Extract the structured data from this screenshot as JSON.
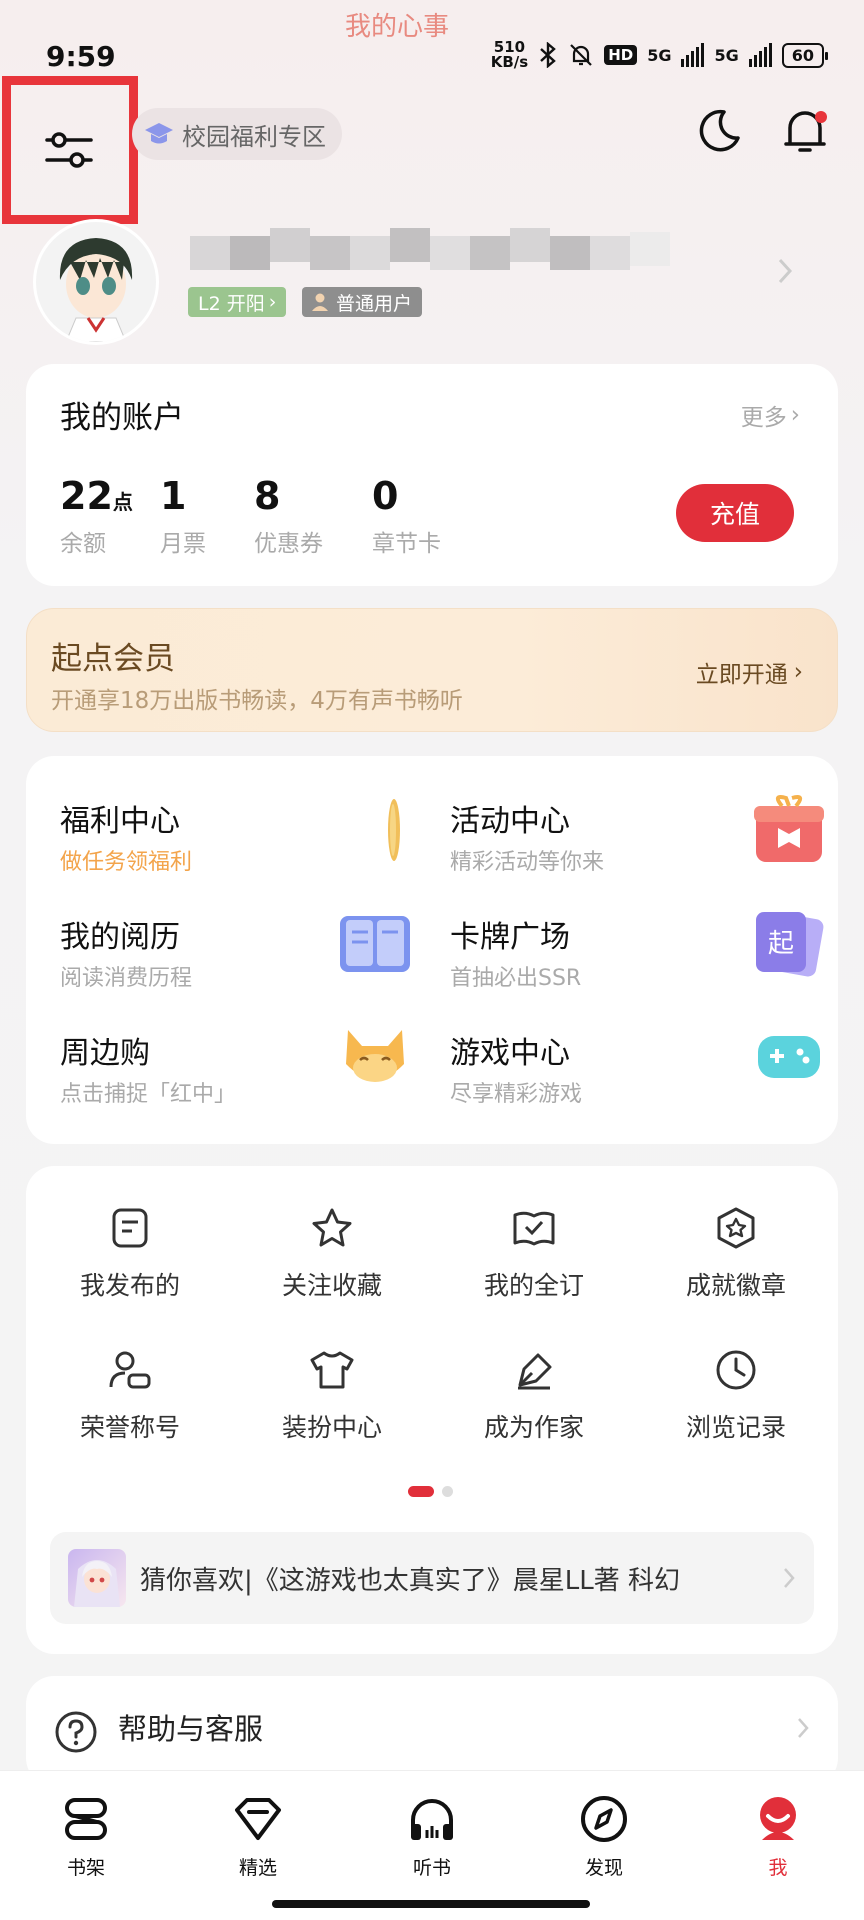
{
  "status_bar": {
    "time": "9:59",
    "top_tag": "我的心事",
    "net_speed_top": "510",
    "net_speed_unit": "KB/s",
    "hd_label": "HD",
    "sim1": "5G",
    "sim2": "5G",
    "battery": "60"
  },
  "header": {
    "campus_zone": "校园福利专区"
  },
  "profile": {
    "level_badge": "L2 开阳",
    "user_type": "普通用户"
  },
  "account": {
    "title": "我的账户",
    "more": "更多",
    "stats": [
      {
        "value": "22",
        "unit": "点",
        "label": "余额"
      },
      {
        "value": "1",
        "unit": "",
        "label": "月票"
      },
      {
        "value": "8",
        "unit": "",
        "label": "优惠券"
      },
      {
        "value": "0",
        "unit": "",
        "label": "章节卡"
      }
    ],
    "recharge": "充值"
  },
  "vip": {
    "title": "起点会员",
    "subtitle": "开通享18万出版书畅读，4万有声书畅听",
    "action": "立即开通"
  },
  "functions": [
    {
      "title": "福利中心",
      "subtitle": "做任务领福利",
      "icon": "coin-icon"
    },
    {
      "title": "活动中心",
      "subtitle": "精彩活动等你来",
      "icon": "gift-box-icon"
    },
    {
      "title": "我的阅历",
      "subtitle": "阅读消费历程",
      "icon": "open-book-icon"
    },
    {
      "title": "卡牌广场",
      "subtitle": "首抽必出SSR",
      "icon": "cards-icon"
    },
    {
      "title": "周边购",
      "subtitle": "点击捕捉「红中」",
      "icon": "fox-icon"
    },
    {
      "title": "游戏中心",
      "subtitle": "尽享精彩游戏",
      "icon": "gamepad-icon"
    }
  ],
  "grid": [
    {
      "label": "我发布的",
      "icon": "post-icon"
    },
    {
      "label": "关注收藏",
      "icon": "star-icon"
    },
    {
      "label": "我的全订",
      "icon": "subscribe-book-icon"
    },
    {
      "label": "成就徽章",
      "icon": "badge-icon"
    },
    {
      "label": "荣誉称号",
      "icon": "honor-user-icon"
    },
    {
      "label": "装扮中心",
      "icon": "shirt-icon"
    },
    {
      "label": "成为作家",
      "icon": "pen-icon"
    },
    {
      "label": "浏览记录",
      "icon": "clock-icon"
    }
  ],
  "recommendation": "猜你喜欢|《这游戏也太真实了》晨星LL著 科幻",
  "help": "帮助与客服",
  "tabs": [
    {
      "label": "书架",
      "icon": "bookshelf-icon",
      "active": false
    },
    {
      "label": "精选",
      "icon": "diamond-icon",
      "active": false
    },
    {
      "label": "听书",
      "icon": "headphones-icon",
      "active": false
    },
    {
      "label": "发现",
      "icon": "compass-icon",
      "active": false
    },
    {
      "label": "我",
      "icon": "me-icon",
      "active": true
    }
  ],
  "colors": {
    "accent": "#e12f3a",
    "highlight_box": "#e8353b",
    "vip_text": "#6a4a22",
    "task_orange": "#f3a44b"
  }
}
